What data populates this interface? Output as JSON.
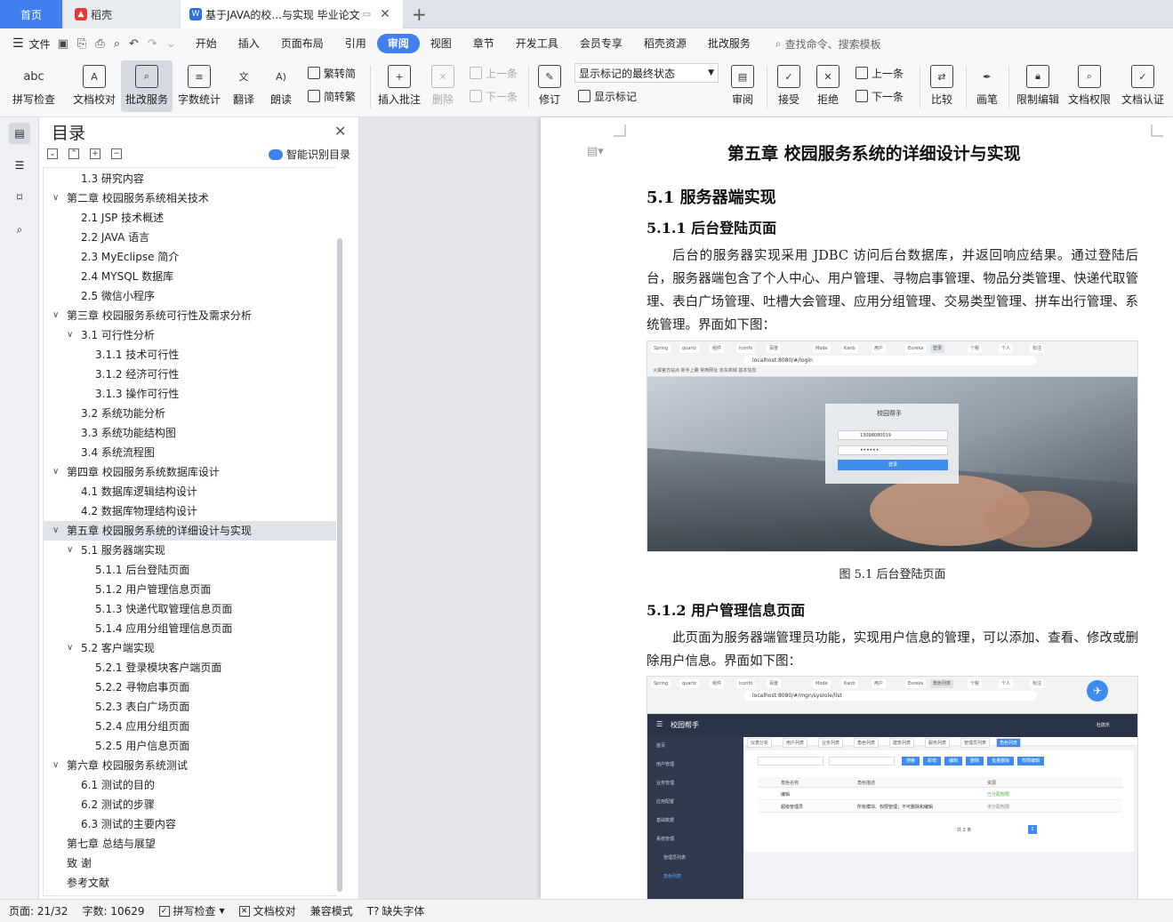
{
  "tabs": {
    "home": "首页",
    "wps": "稻壳",
    "doc": "基于JAVA的校...与实现 毕业论文"
  },
  "menubar": {
    "file": "文件",
    "items": [
      "开始",
      "插入",
      "页面布局",
      "引用",
      "审阅",
      "视图",
      "章节",
      "开发工具",
      "会员专享",
      "稻壳资源",
      "批改服务"
    ],
    "active": "审阅",
    "search": "查找命令、搜索模板"
  },
  "ribbon": {
    "spell": "拼写检查",
    "doccheck": "文档校对",
    "correct": "批改服务",
    "wordcount": "字数统计",
    "translate": "翻译",
    "read": "朗读",
    "trad": "繁转简",
    "simp": "简转繁",
    "insert_comment": "插入批注",
    "delete": "删除",
    "prev": "上一条",
    "next": "下一条",
    "revise": "修订",
    "markup_state": "显示标记的最终状态",
    "show_markup": "显示标记",
    "review": "审阅",
    "accept": "接受",
    "reject": "拒绝",
    "prev2": "上一条",
    "next2": "下一条",
    "compare": "比较",
    "pen": "画笔",
    "restrict": "限制编辑",
    "rights": "文档权限",
    "certify": "文档认证"
  },
  "toc": {
    "title": "目录",
    "smart": "智能识别目录",
    "items": [
      {
        "text": "1.3  研究内容",
        "level": 2,
        "arrow": ""
      },
      {
        "text": "第二章  校园服务系统相关技术",
        "level": 1,
        "arrow": "v"
      },
      {
        "text": "2.1 JSP 技术概述",
        "level": 2,
        "arrow": ""
      },
      {
        "text": "2.2 JAVA 语言",
        "level": 2,
        "arrow": ""
      },
      {
        "text": "2.3 MyEclipse 简介",
        "level": 2,
        "arrow": ""
      },
      {
        "text": "2.4 MYSQL 数据库",
        "level": 2,
        "arrow": ""
      },
      {
        "text": "2.5  微信小程序",
        "level": 2,
        "arrow": ""
      },
      {
        "text": "第三章  校园服务系统可行性及需求分析",
        "level": 1,
        "arrow": "v"
      },
      {
        "text": "3.1  可行性分析",
        "level": 2,
        "arrow": "v"
      },
      {
        "text": "3.1.1 技术可行性",
        "level": 3,
        "arrow": ""
      },
      {
        "text": "3.1.2  经济可行性",
        "level": 3,
        "arrow": ""
      },
      {
        "text": "3.1.3 操作可行性",
        "level": 3,
        "arrow": ""
      },
      {
        "text": "3.2  系统功能分析",
        "level": 2,
        "arrow": ""
      },
      {
        "text": "3.3  系统功能结构图",
        "level": 2,
        "arrow": ""
      },
      {
        "text": "3.4  系统流程图",
        "level": 2,
        "arrow": ""
      },
      {
        "text": "第四章  校园服务系统数据库设计",
        "level": 1,
        "arrow": "v"
      },
      {
        "text": "4.1  数据库逻辑结构设计",
        "level": 2,
        "arrow": ""
      },
      {
        "text": "4.2  数据库物理结构设计",
        "level": 2,
        "arrow": ""
      },
      {
        "text": "第五章  校园服务系统的详细设计与实现",
        "level": 1,
        "arrow": "v",
        "hl": true
      },
      {
        "text": "5.1  服务器端实现",
        "level": 2,
        "arrow": "v"
      },
      {
        "text": "5.1.1  后台登陆页面",
        "level": 3,
        "arrow": ""
      },
      {
        "text": "5.1.2  用户管理信息页面",
        "level": 3,
        "arrow": ""
      },
      {
        "text": "5.1.3  快递代取管理信息页面",
        "level": 3,
        "arrow": ""
      },
      {
        "text": "5.1.4  应用分组管理信息页面",
        "level": 3,
        "arrow": ""
      },
      {
        "text": "5.2  客户端实现",
        "level": 2,
        "arrow": "v"
      },
      {
        "text": "5.2.1  登录模块客户端页面",
        "level": 3,
        "arrow": ""
      },
      {
        "text": "5.2.2  寻物启事页面",
        "level": 3,
        "arrow": ""
      },
      {
        "text": "5.2.3  表白广场页面",
        "level": 3,
        "arrow": ""
      },
      {
        "text": "5.2.4  应用分组页面",
        "level": 3,
        "arrow": ""
      },
      {
        "text": "5.2.5  用户信息页面",
        "level": 3,
        "arrow": ""
      },
      {
        "text": "第六章  校园服务系统测试",
        "level": 1,
        "arrow": "v"
      },
      {
        "text": "6.1  测试的目的",
        "level": 2,
        "arrow": ""
      },
      {
        "text": "6.2  测试的步骤",
        "level": 2,
        "arrow": ""
      },
      {
        "text": "6.3  测试的主要内容",
        "level": 2,
        "arrow": ""
      },
      {
        "text": "第七章  总结与展望",
        "level": 1,
        "arrow": ""
      },
      {
        "text": "致  谢",
        "level": 1,
        "arrow": ""
      },
      {
        "text": "参考文献",
        "level": 1,
        "arrow": ""
      }
    ]
  },
  "document": {
    "chapter_title": "第五章  校园服务系统的详细设计与实现",
    "h51": "5.1  服务器端实现",
    "h511": "5.1.1  后台登陆页面",
    "p1": "后台的服务器实现采用 JDBC 访问后台数据库，并返回响应结果。通过登陆后台，服务器端包含了个人中心、用户管理、寻物启事管理、物品分类管理、快递代取管理、表白广场管理、吐槽大会管理、应用分组管理、交易类型管理、拼车出行管理、系统管理。界面如下图：",
    "fig1_caption": "图 5.1 后台登陆页面",
    "h512": "5.1.2  用户管理信息页面",
    "p2": "此页面为服务器端管理员功能，实现用户信息的管理，可以添加、查看、修改或删除用户信息。界面如下图：",
    "fig1": {
      "url": "localhost:8080/#/login",
      "app_title": "校园帮手",
      "phone": "13098080019",
      "password": "••••••",
      "login_btn": "登录",
      "bookmarks": "火狐官方站点   新手上路   常用网址   京东商城   基本信息"
    },
    "fig2": {
      "url": "localhost:8080/#/mgn/sysrole/list",
      "app_title": "校园帮手",
      "user": "杜鹃乐",
      "menu": [
        "首页",
        "用户管理",
        "业务管理",
        "应用配置",
        "基础数据",
        "系统管理",
        "管理员列表",
        "角色列表"
      ],
      "tabs": [
        "仪表分析",
        "用户列表",
        "业务列表",
        "角色列表",
        "建筑列表",
        "服务列表",
        "管理员列表",
        "角色列表"
      ],
      "cols": [
        "角色名称",
        "角色描述",
        "资源"
      ],
      "rows": [
        [
          "编辑",
          "",
          "已分配权限"
        ],
        [
          "超级管理员",
          "所有模块、权限管理；不可删除和编辑",
          "未分配权限"
        ]
      ],
      "pager": "共 2 条",
      "btns": [
        "搜索",
        "新增",
        "编辑",
        "删除",
        "批量删除",
        "权限编辑"
      ]
    }
  },
  "status": {
    "page": "页面: 21/32",
    "words": "字数: 10629",
    "spell": "拼写检查",
    "doccheck": "文档校对",
    "compat": "兼容模式",
    "missing_font": "缺失字体"
  }
}
